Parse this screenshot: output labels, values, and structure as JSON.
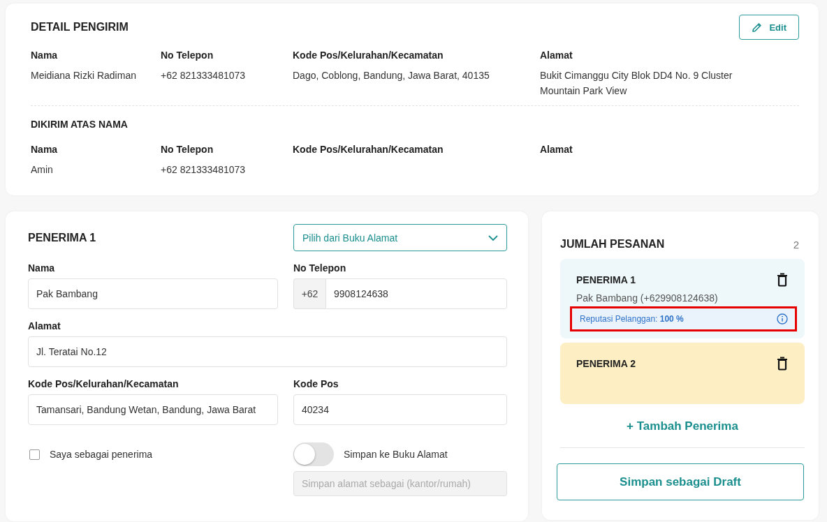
{
  "sender": {
    "title": "DETAIL PENGIRIM",
    "edit_button": "Edit",
    "fields": [
      {
        "label": "Nama",
        "value": "Meidiana Rizki Radiman"
      },
      {
        "label": "No Telepon",
        "value": "+62 821333481073"
      },
      {
        "label": "Kode Pos/Kelurahan/Kecamatan",
        "value": "Dago, Coblong, Bandung, Jawa Barat, 40135"
      },
      {
        "label": "Alamat",
        "value": "Bukit Cimanggu City Blok DD4 No. 9 Cluster Mountain Park View"
      }
    ]
  },
  "shipped_as": {
    "title": "DIKIRIM ATAS NAMA",
    "fields": [
      {
        "label": "Nama",
        "value": "Amin"
      },
      {
        "label": "No Telepon",
        "value": "+62 821333481073"
      },
      {
        "label": "Kode Pos/Kelurahan/Kecamatan"
      },
      {
        "label": "Alamat"
      }
    ]
  },
  "recipient_form": {
    "title": "PENERIMA 1",
    "address_book_select": "Pilih dari Buku Alamat",
    "name": {
      "label": "Nama",
      "value": "Pak Bambang"
    },
    "phone": {
      "label": "No Telepon",
      "prefix": "+62",
      "value": "9908124638"
    },
    "address": {
      "label": "Alamat",
      "value": "Jl. Teratai No.12"
    },
    "area": {
      "label": "Kode Pos/Kelurahan/Kecamatan",
      "value": "Tamansari, Bandung Wetan, Bandung, Jawa Barat"
    },
    "postcode": {
      "label": "Kode Pos",
      "value": "40234"
    },
    "self_checkbox": {
      "label": "Saya sebagai penerima",
      "checked": false
    },
    "save_toggle": {
      "label": "Simpan ke Buku Alamat",
      "on": false
    },
    "address_label_field": {
      "placeholder": "Simpan alamat sebagai (kantor/rumah)"
    }
  },
  "summary": {
    "title": "JUMLAH PESANAN",
    "count": "2",
    "recipients": [
      {
        "title": "PENERIMA 1",
        "color": "#eef8fa",
        "detail": "Pak Bambang (+629908124638)",
        "reputation": {
          "text": "Reputasi Pelanggan: **100 %**",
          "highlighted": true
        }
      },
      {
        "title": "PENERIMA 2",
        "color": "#fdefc3"
      }
    ],
    "add_button": "+ Tambah Penerima",
    "draft_button": "Simpan sebagai Draft"
  }
}
